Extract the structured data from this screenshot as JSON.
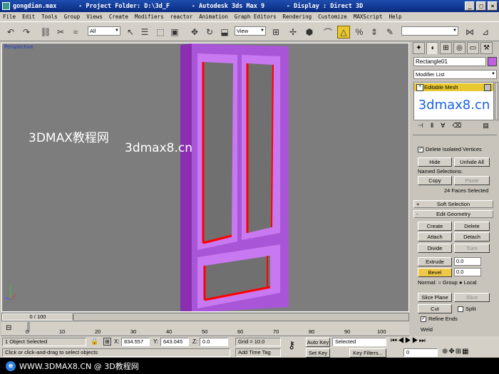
{
  "window": {
    "title": "gongdian.max      - Project Folder: D:\\3d_F      - Autodesk 3ds Max 9      - Display : Direct 3D",
    "minimize": "_",
    "maximize": "□",
    "close": "×"
  },
  "menu": [
    "File",
    "Edit",
    "Tools",
    "Group",
    "Views",
    "Create",
    "Modifiers",
    "reactor",
    "Animation",
    "Graph Editors",
    "Rendering",
    "Customize",
    "MAXScript",
    "Help"
  ],
  "toolbar": {
    "selection_filter": "All",
    "ref_coord": "View",
    "named_sets": ""
  },
  "viewport": {
    "label": "Perspective",
    "watermark_1": "3DMAX教程网",
    "watermark_2": "3dmax8.cn"
  },
  "panel": {
    "object_name": "Rectangle01",
    "object_color": "#c060e0",
    "modifier_list": "Modifier List",
    "stack_item": "Editable Mesh",
    "logo": "3dmax8.cn",
    "delete_isolated": "Delete Isolated Vertices",
    "hide": "Hide",
    "unhide_all": "Unhide All",
    "named_selections": "Named Selections:",
    "copy": "Copy",
    "paste": "Paste",
    "faces_selected": "24 Faces Selected",
    "soft_selection": "Soft Selection",
    "edit_geometry": "Edit Geometry",
    "create": "Create",
    "delete": "Delete",
    "attach": "Attach",
    "detach": "Detach",
    "divide": "Divide",
    "turn": "Turn",
    "extrude": "Extrude",
    "extrude_value": "0.0",
    "bevel": "Bevel",
    "bevel_value": "0.0",
    "normal_label": "Normal:",
    "normal_group": "Group",
    "normal_local": "Local",
    "slice_plane": "Slice Plane",
    "slice": "Slice",
    "cut": "Cut",
    "split": "Split",
    "refine_ends": "Refine Ends",
    "weld": "Weld"
  },
  "timeline": {
    "frame": "0 / 100",
    "ticks": [
      "0",
      "10",
      "20",
      "30",
      "40",
      "50",
      "60",
      "70",
      "80",
      "90",
      "100"
    ]
  },
  "status": {
    "selected": "1 Object Selected",
    "prompt": "Click or click-and-drag to select objects",
    "x_label": "X:",
    "x": "834.557",
    "y_label": "Y:",
    "y": "643.045",
    "z_label": "Z:",
    "z": "0.0",
    "grid": "Grid = 10.0",
    "add_time_tag": "Add Time Tag",
    "auto_key": "Auto Key",
    "set_key": "Set Key",
    "key_mode": "Selected",
    "key_filters": "Key Filters...",
    "current_frame": "0"
  },
  "footer": {
    "text": "WWW.3DMAX8.CN @ 3D教程网"
  }
}
